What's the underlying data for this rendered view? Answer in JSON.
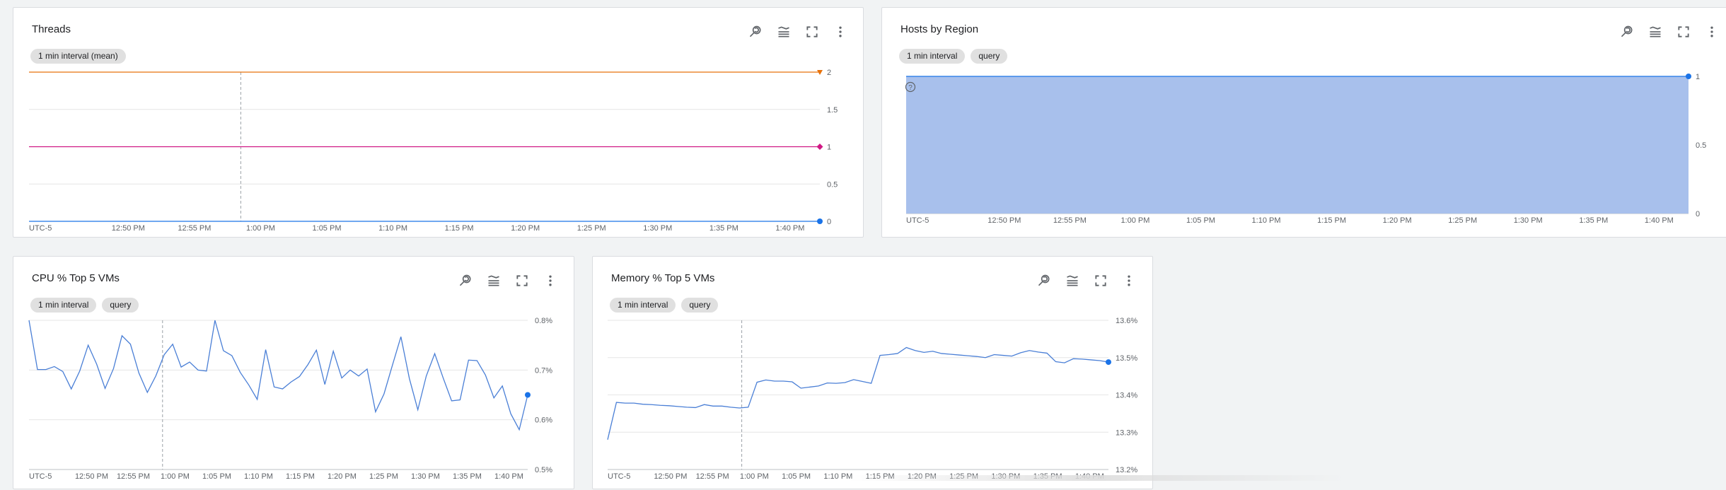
{
  "colors": {
    "blue": "#1a73e8",
    "blue_line": "#4a7fd6",
    "area_fill": "#a8c0ec",
    "orange": "#e8710a",
    "magenta": "#d01884",
    "grid": "#e6e6e6",
    "cursor": "#9aa0a6"
  },
  "toolbar_icons": [
    "zoom-reset-icon",
    "legend-icon",
    "fullscreen-icon",
    "more-vert-icon"
  ],
  "charts": [
    {
      "title": "Threads",
      "chips": [
        "1 min interval (mean)"
      ],
      "timezone": "UTC-5",
      "x_ticks": [
        "12:50 PM",
        "12:55 PM",
        "1:00 PM",
        "1:05 PM",
        "1:10 PM",
        "1:15 PM",
        "1:20 PM",
        "1:25 PM",
        "1:30 PM",
        "1:35 PM",
        "1:40 PM"
      ],
      "y_ticks": [
        "0",
        "0.5",
        "1",
        "1.5",
        "2"
      ]
    },
    {
      "title": "Hosts by Region",
      "chips": [
        "1 min interval",
        "query"
      ],
      "timezone": "UTC-5",
      "x_ticks": [
        "12:50 PM",
        "12:55 PM",
        "1:00 PM",
        "1:05 PM",
        "1:10 PM",
        "1:15 PM",
        "1:20 PM",
        "1:25 PM",
        "1:30 PM",
        "1:35 PM",
        "1:40 PM"
      ],
      "y_ticks": [
        "0",
        "0.5",
        "1"
      ],
      "help_glyph": "?"
    },
    {
      "title": "CPU % Top 5 VMs",
      "chips": [
        "1 min interval",
        "query"
      ],
      "timezone": "UTC-5",
      "x_ticks": [
        "12:50 PM",
        "12:55 PM",
        "1:00 PM",
        "1:05 PM",
        "1:10 PM",
        "1:15 PM",
        "1:20 PM",
        "1:25 PM",
        "1:30 PM",
        "1:35 PM",
        "1:40 PM"
      ],
      "y_ticks": [
        "0.5%",
        "0.6%",
        "0.7%",
        "0.8%"
      ]
    },
    {
      "title": "Memory % Top 5 VMs",
      "chips": [
        "1 min interval",
        "query"
      ],
      "timezone": "UTC-5",
      "x_ticks": [
        "12:50 PM",
        "12:55 PM",
        "1:00 PM",
        "1:05 PM",
        "1:10 PM",
        "1:15 PM",
        "1:20 PM",
        "1:25 PM",
        "1:30 PM",
        "1:35 PM",
        "1:40 PM"
      ],
      "y_ticks": [
        "13.2%",
        "13.3%",
        "13.4%",
        "13.5%",
        "13.6%"
      ]
    }
  ],
  "chart_data": [
    {
      "type": "line",
      "title": "Threads",
      "ylim": [
        0,
        2
      ],
      "grid": true,
      "series": [
        {
          "color": "#e8710a",
          "marker": "triangle",
          "values": [
            2,
            2
          ]
        },
        {
          "color": "#d01884",
          "marker": "diamond",
          "values": [
            1,
            1
          ]
        },
        {
          "color": "#1a73e8",
          "marker": "circle",
          "values": [
            0,
            0
          ]
        }
      ]
    },
    {
      "type": "area",
      "title": "Hosts by Region",
      "ylim": [
        0,
        1
      ],
      "grid": true,
      "series": [
        {
          "color": "#1a73e8",
          "marker": "circle",
          "values": [
            1,
            1
          ]
        }
      ]
    },
    {
      "type": "line",
      "title": "CPU % Top 5 VMs",
      "ylim": [
        0.5,
        0.8
      ],
      "grid": true,
      "series": [
        {
          "color": "#4a7fd6",
          "marker": "circle",
          "values": [
            0.8,
            0.701,
            0.701,
            0.707,
            0.697,
            0.662,
            0.698,
            0.75,
            0.712,
            0.663,
            0.703,
            0.769,
            0.752,
            0.694,
            0.655,
            0.688,
            0.731,
            0.752,
            0.706,
            0.716,
            0.7,
            0.698,
            0.8,
            0.739,
            0.729,
            0.695,
            0.67,
            0.641,
            0.741,
            0.666,
            0.662,
            0.676,
            0.687,
            0.711,
            0.74,
            0.671,
            0.738,
            0.684,
            0.7,
            0.688,
            0.702,
            0.616,
            0.652,
            0.71,
            0.767,
            0.683,
            0.62,
            0.688,
            0.733,
            0.684,
            0.638,
            0.64,
            0.72,
            0.719,
            0.69,
            0.644,
            0.668,
            0.612,
            0.58,
            0.65
          ]
        }
      ]
    },
    {
      "type": "line",
      "title": "Memory % Top 5 VMs",
      "ylim": [
        13.2,
        13.6
      ],
      "grid": true,
      "series": [
        {
          "color": "#4a7fd6",
          "marker": "circle",
          "values": [
            13.28,
            13.38,
            13.378,
            13.378,
            13.375,
            13.374,
            13.372,
            13.371,
            13.369,
            13.367,
            13.366,
            13.374,
            13.37,
            13.37,
            13.367,
            13.365,
            13.367,
            13.434,
            13.44,
            13.437,
            13.437,
            13.435,
            13.418,
            13.421,
            13.424,
            13.432,
            13.431,
            13.433,
            13.441,
            13.436,
            13.431,
            13.506,
            13.508,
            13.511,
            13.527,
            13.519,
            13.514,
            13.517,
            13.511,
            13.509,
            13.507,
            13.505,
            13.503,
            13.5,
            13.508,
            13.506,
            13.504,
            13.513,
            13.519,
            13.515,
            13.512,
            13.489,
            13.486,
            13.497,
            13.496,
            13.494,
            13.492,
            13.488
          ]
        }
      ]
    }
  ]
}
